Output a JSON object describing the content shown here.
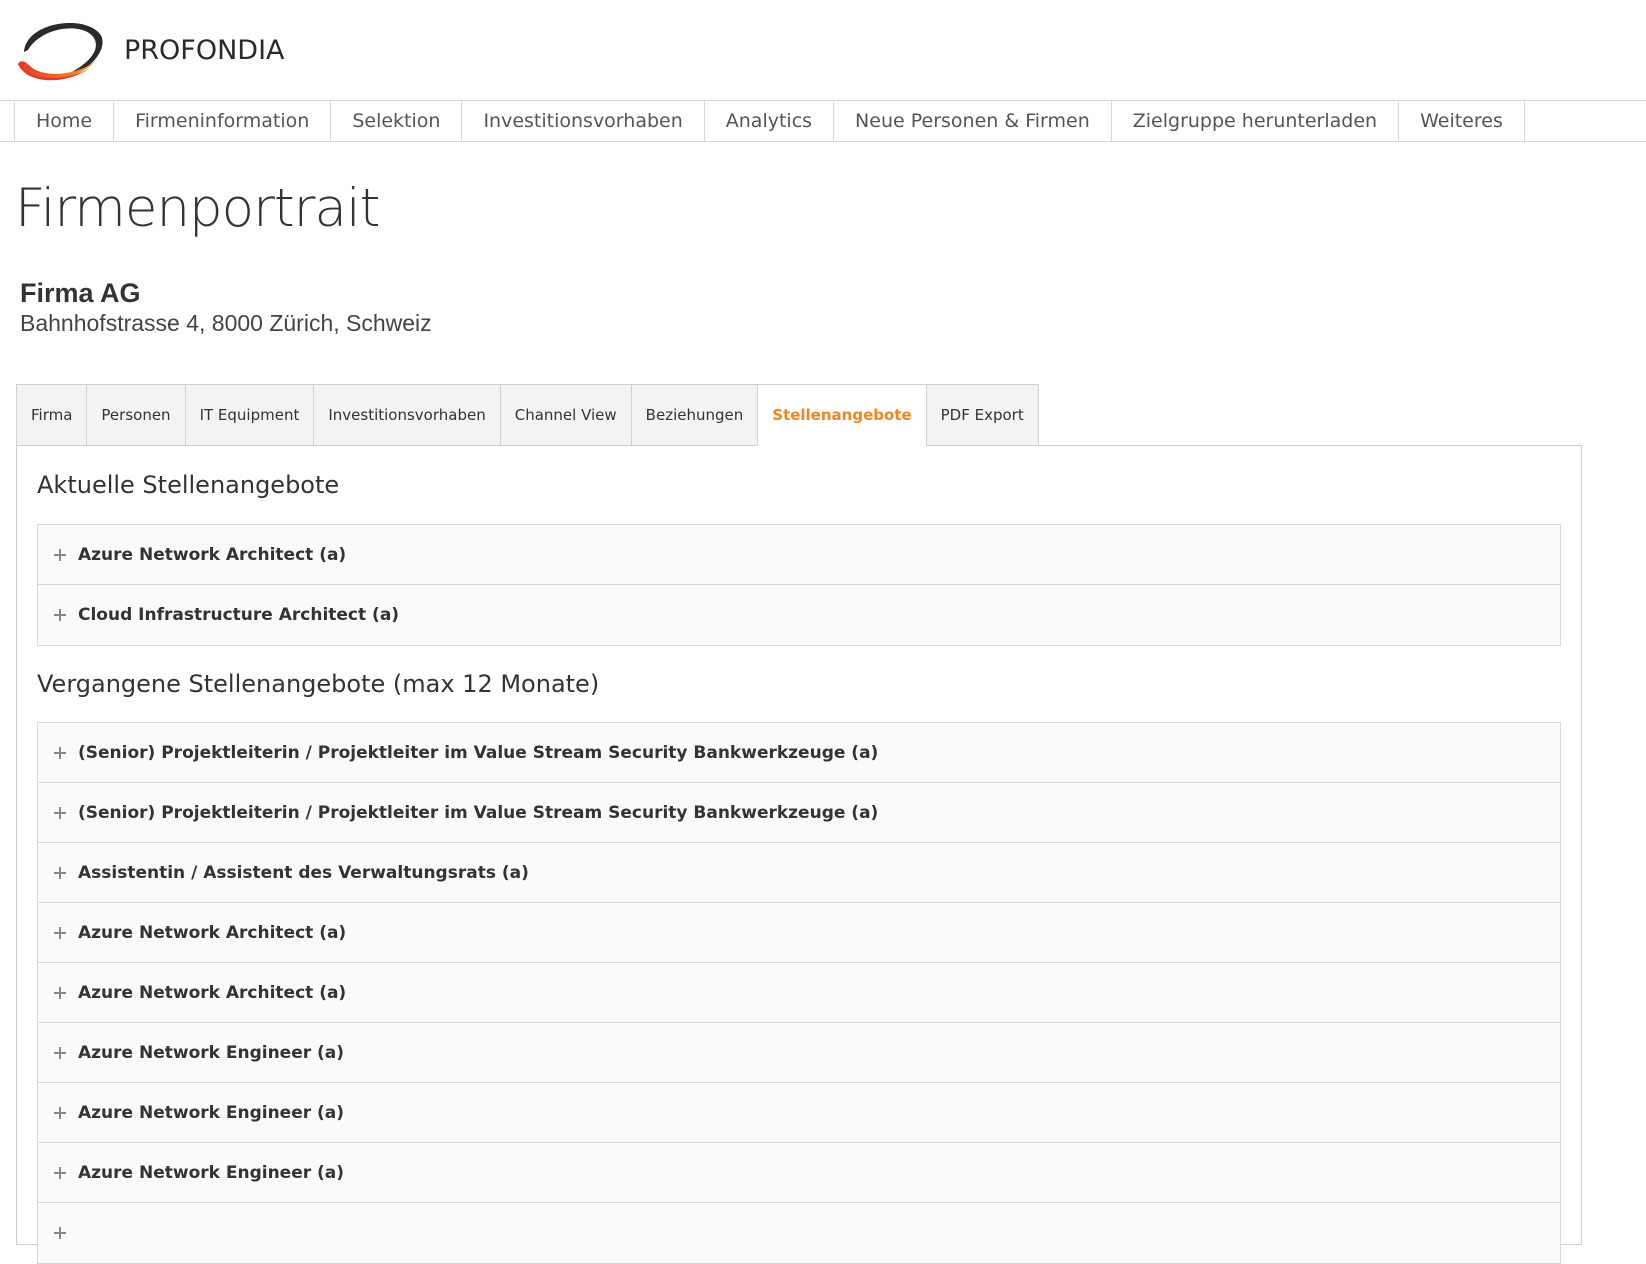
{
  "brand": {
    "name": "PROFONDIA",
    "colors": {
      "accent": "#f0861e",
      "logo_gradient_start": "#e4362b",
      "logo_gradient_end": "#f7a021",
      "logo_dark": "#2a2a2a"
    }
  },
  "topnav": {
    "items": [
      {
        "label": "Home"
      },
      {
        "label": "Firmeninformation"
      },
      {
        "label": "Selektion"
      },
      {
        "label": "Investitionsvorhaben"
      },
      {
        "label": "Analytics"
      },
      {
        "label": "Neue Personen & Firmen"
      },
      {
        "label": "Zielgruppe herunterladen"
      },
      {
        "label": "Weiteres"
      }
    ]
  },
  "page": {
    "title": "Firmenportrait"
  },
  "company": {
    "name": "Firma AG",
    "address": "Bahnhofstrasse 4, 8000 Zürich, Schweiz"
  },
  "tabs": {
    "items": [
      {
        "label": "Firma",
        "active": false
      },
      {
        "label": "Personen",
        "active": false
      },
      {
        "label": "IT Equipment",
        "active": false
      },
      {
        "label": "Investitionsvorhaben",
        "active": false
      },
      {
        "label": "Channel View",
        "active": false
      },
      {
        "label": "Beziehungen",
        "active": false
      },
      {
        "label": "Stellenangebote",
        "active": true
      },
      {
        "label": "PDF Export",
        "active": false
      }
    ]
  },
  "current_jobs": {
    "heading": "Aktuelle Stellenangebote",
    "items": [
      {
        "title": "Azure Network Architect (a)",
        "icon": "plus-icon"
      },
      {
        "title": "Cloud Infrastructure Architect (a)",
        "icon": "plus-icon"
      }
    ]
  },
  "past_jobs": {
    "heading": "Vergangene Stellenangebote (max 12 Monate)",
    "items": [
      {
        "title": "(Senior) Projektleiterin / Projektleiter im Value Stream Security Bankwerkzeuge (a)",
        "icon": "plus-icon"
      },
      {
        "title": "(Senior) Projektleiterin / Projektleiter im Value Stream Security Bankwerkzeuge (a)",
        "icon": "plus-icon"
      },
      {
        "title": "Assistentin / Assistent des Verwaltungsrats (a)",
        "icon": "plus-icon"
      },
      {
        "title": "Azure Network Architect (a)",
        "icon": "plus-icon"
      },
      {
        "title": "Azure Network Architect (a)",
        "icon": "plus-icon"
      },
      {
        "title": "Azure Network Engineer (a)",
        "icon": "plus-icon"
      },
      {
        "title": "Azure Network Engineer (a)",
        "icon": "plus-icon"
      },
      {
        "title": "Azure Network Engineer (a)",
        "icon": "plus-icon"
      },
      {
        "title": "",
        "icon": "plus-icon"
      }
    ]
  }
}
